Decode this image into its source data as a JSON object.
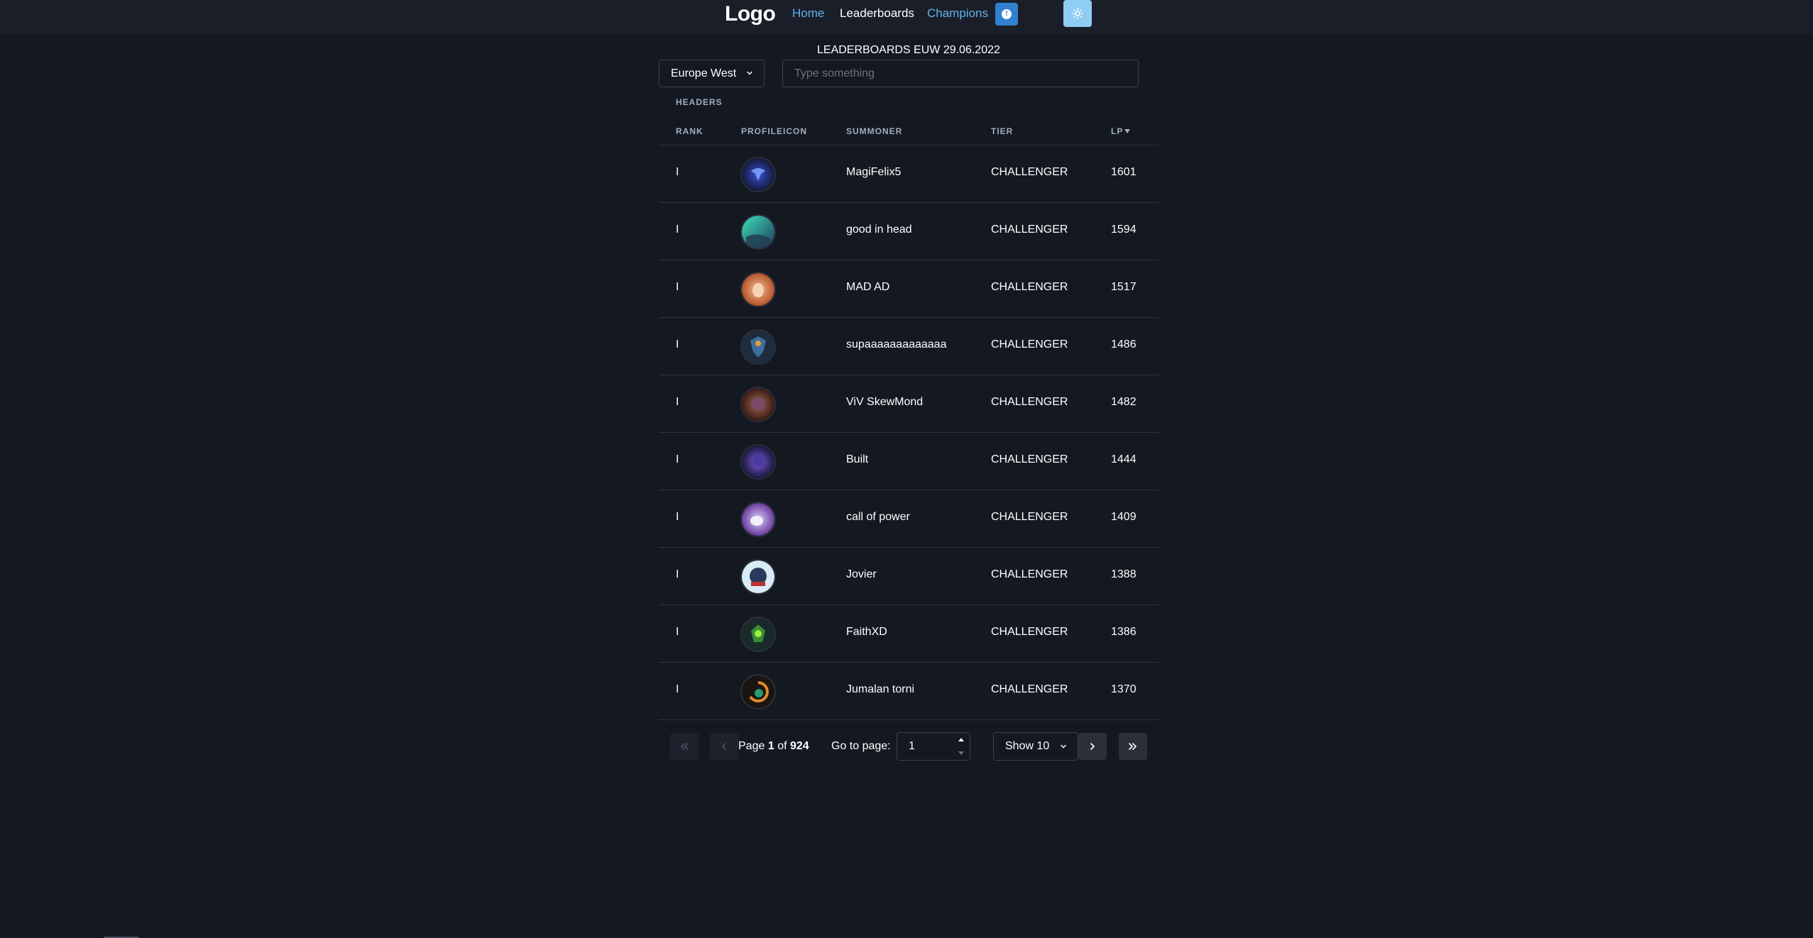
{
  "nav": {
    "logo": "Logo",
    "links": [
      "Home",
      "Leaderboards",
      "Champions"
    ]
  },
  "heading": "LEADERBOARDS EUW 29.06.2022",
  "filters": {
    "region": "Europe West",
    "search_placeholder": "Type something"
  },
  "table": {
    "group_label": "HEADERS",
    "columns": [
      "RANK",
      "PROFILEICON",
      "SUMMONER",
      "TIER",
      "LP"
    ],
    "sort_column": "LP",
    "rows": [
      {
        "rank": "I",
        "summoner": "MagiFelix5",
        "tier": "CHALLENGER",
        "lp": "1601"
      },
      {
        "rank": "I",
        "summoner": "good in head",
        "tier": "CHALLENGER",
        "lp": "1594"
      },
      {
        "rank": "I",
        "summoner": "MAD AD",
        "tier": "CHALLENGER",
        "lp": "1517"
      },
      {
        "rank": "I",
        "summoner": "supaaaaaaaaaaaaa",
        "tier": "CHALLENGER",
        "lp": "1486"
      },
      {
        "rank": "I",
        "summoner": "ViV SkewMond",
        "tier": "CHALLENGER",
        "lp": "1482"
      },
      {
        "rank": "I",
        "summoner": "Built",
        "tier": "CHALLENGER",
        "lp": "1444"
      },
      {
        "rank": "I",
        "summoner": "call of power",
        "tier": "CHALLENGER",
        "lp": "1409"
      },
      {
        "rank": "I",
        "summoner": "Jovier",
        "tier": "CHALLENGER",
        "lp": "1388"
      },
      {
        "rank": "I",
        "summoner": "FaithXD",
        "tier": "CHALLENGER",
        "lp": "1386"
      },
      {
        "rank": "I",
        "summoner": "Jumalan torni",
        "tier": "CHALLENGER",
        "lp": "1370"
      }
    ]
  },
  "pagination": {
    "page_prefix": "Page",
    "current_page": "1",
    "of_word": "of",
    "total_pages": "924",
    "goto_label": "Go to page:",
    "goto_value": "1",
    "page_size": "Show 10"
  },
  "colors": {
    "background": "#141821",
    "accent_link": "#63b3ed",
    "info_button": "#3182ce",
    "theme_button": "#90cdf4"
  }
}
